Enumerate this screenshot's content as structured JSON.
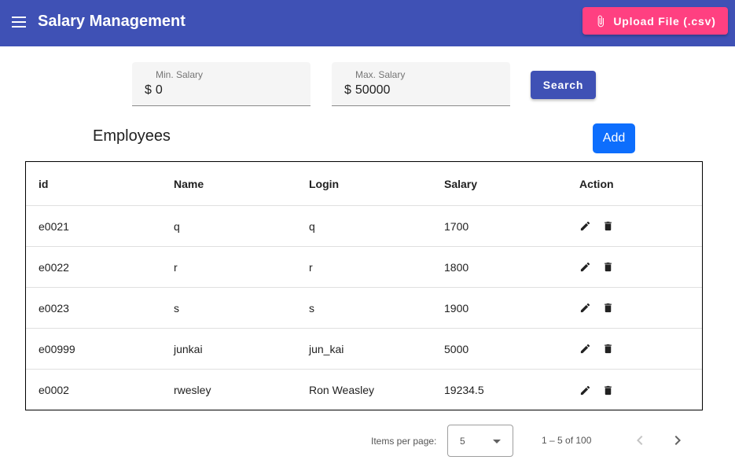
{
  "app": {
    "title": "Salary Management",
    "upload_label": "Upload File (.csv)"
  },
  "filters": {
    "min": {
      "label": "Min. Salary",
      "prefix": "$",
      "value": "0"
    },
    "max": {
      "label": "Max. Salary",
      "prefix": "$",
      "value": "50000"
    },
    "search_label": "Search"
  },
  "section": {
    "title": "Employees",
    "add_label": "Add"
  },
  "table": {
    "headers": [
      "id",
      "Name",
      "Login",
      "Salary",
      "Action"
    ],
    "rows": [
      [
        "e0021",
        "q",
        "q",
        "1700"
      ],
      [
        "e0022",
        "r",
        "r",
        "1800"
      ],
      [
        "e0023",
        "s",
        "s",
        "1900"
      ],
      [
        "e00999",
        "junkai",
        "jun_kai",
        "5000"
      ],
      [
        "e0002",
        "rwesley",
        "Ron Weasley",
        "19234.5"
      ]
    ]
  },
  "paginator": {
    "items_per_page_label": "Items per page:",
    "page_size": "5",
    "range": "1 – 5 of 100"
  },
  "icons": {
    "menu": "menu-icon",
    "attach": "paperclip-icon",
    "edit": "pencil-icon",
    "delete": "trash-icon",
    "prev": "chevron-left-icon",
    "next": "chevron-right-icon"
  },
  "colors": {
    "primary": "#3f51b5",
    "accent": "#ff4081",
    "add": "#0d6efd"
  }
}
